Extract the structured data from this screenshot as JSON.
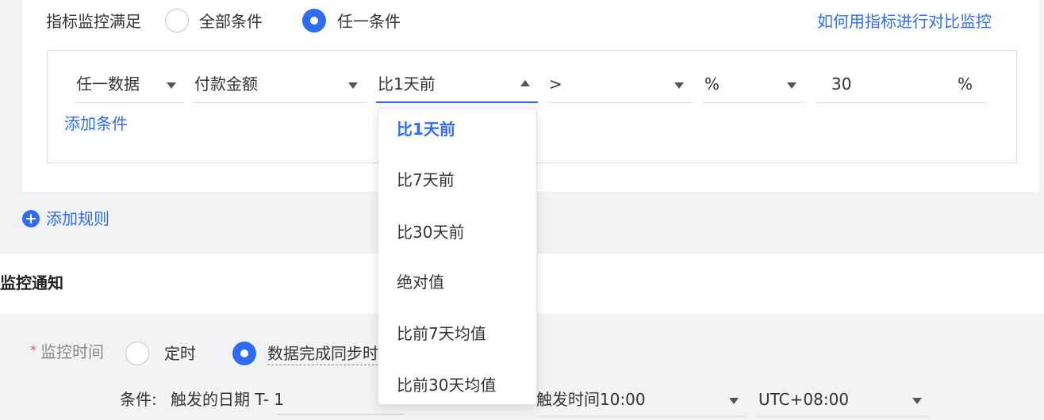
{
  "rule": {
    "monitor_label": "指标监控满足",
    "option_all": "全部条件",
    "option_any": "任一条件",
    "selected_option": "任一条件",
    "help_link": "如何用指标进行对比监控"
  },
  "condition": {
    "scope": "任一数据",
    "metric": "付款金额",
    "compare": "比1天前",
    "operator": ">",
    "unit_type": "%",
    "value": "30",
    "value_unit": "%",
    "add_condition": "添加条件"
  },
  "add_rule": "添加规则",
  "notification": {
    "section_title": "监控通知",
    "time_label": "监控时间",
    "required_mark": "*",
    "option_scheduled": "定时",
    "option_data_sync": "数据完成同步时",
    "condition_label": "条件:",
    "trigger_date": "触发的日期 T- 1",
    "trigger_time": "触发时间10:00",
    "timezone": "UTC+08:00"
  },
  "dropdown": {
    "options": [
      "比1天前",
      "比7天前",
      "比30天前",
      "绝对值",
      "比前7天均值",
      "比前30天均值"
    ],
    "selected": "比1天前"
  },
  "colors": {
    "accent": "#2f6cf0",
    "required": "#e34d59"
  }
}
